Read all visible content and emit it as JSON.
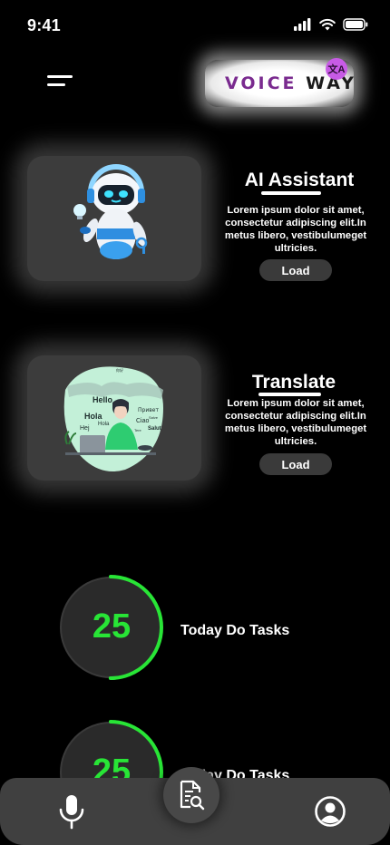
{
  "status": {
    "time": "9:41"
  },
  "header": {
    "logo_text_1": "VOICE",
    "logo_text_2": "WAY",
    "logo_badge": "文A"
  },
  "cards": [
    {
      "title": "AI Assistant",
      "description": "Lorem ipsum dolor sit amet, consectetur adipiscing elit.In metus libero, vestibulumeget ultricies.",
      "button_label": "Load",
      "image_icon": "robot-illustration"
    },
    {
      "title": "Translate",
      "description": "Lorem ipsum dolor sit amet, consectetur adipiscing elit.In metus libero, vestibulumeget ultricies.",
      "button_label": "Load",
      "image_icon": "translation-illustration",
      "image_words": [
        "Hello",
        "Hola",
        "Hola",
        "Hej",
        "Привет",
        "Ciao",
        "Salut",
        "Tere",
        "Salve",
        "你好"
      ]
    }
  ],
  "tasks": [
    {
      "count": "25",
      "label": "Today Do Tasks",
      "progress": 0.5
    },
    {
      "count": "25",
      "label": "Today Do Tasks",
      "progress": 0.5
    }
  ],
  "colors": {
    "accent": "#28e536",
    "logo": "#7a2b8f",
    "badge": "#c85be6"
  },
  "nav": {
    "left_icon": "microphone-icon",
    "center_icon": "document-search-icon",
    "right_icon": "profile-icon"
  }
}
